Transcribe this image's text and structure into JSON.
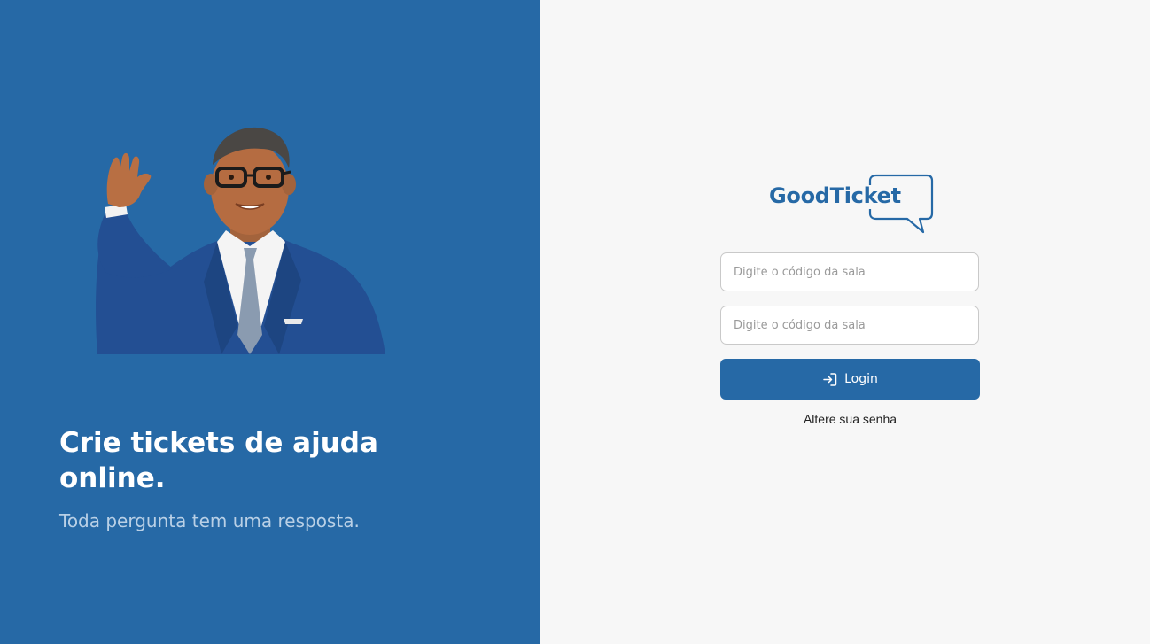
{
  "hero": {
    "title": "Crie tickets de ajuda online.",
    "subtitle": "Toda pergunta tem uma resposta."
  },
  "brand": {
    "name": "GoodTicket",
    "color": "#2669a6",
    "background_right": "#f7f7f7"
  },
  "form": {
    "field1_placeholder": "Digite o código da sala",
    "field2_placeholder": "Digite o código da sala",
    "login_label": "Login",
    "login_icon": "login-icon",
    "change_password_label": "Altere sua senha"
  }
}
